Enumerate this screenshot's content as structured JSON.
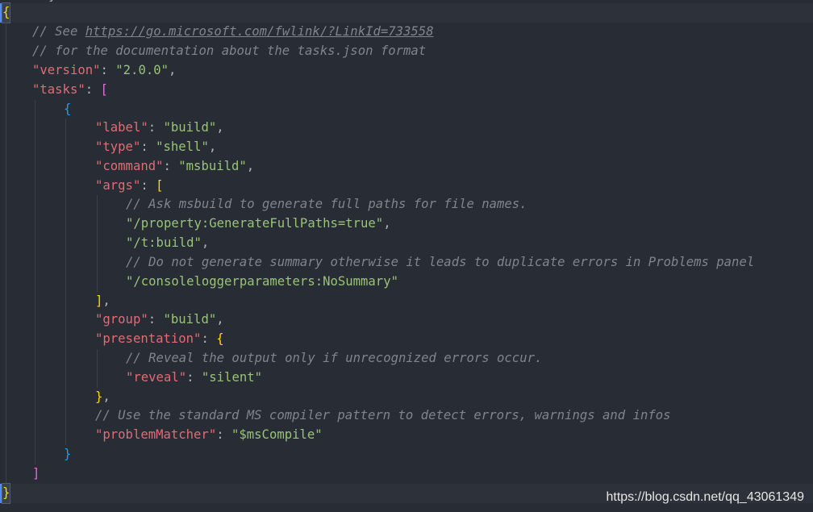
{
  "editor": {
    "comment_see": "// See ",
    "link": "https://go.microsoft.com/fwlink/?LinkId=733558",
    "comment_docs": "// for the documentation about the tasks.json format",
    "version_key": "\"version\"",
    "version_value": "\"2.0.0\"",
    "tasks_key": "\"tasks\"",
    "label_key": "\"label\"",
    "label_value": "\"build\"",
    "type_key": "\"type\"",
    "type_value": "\"shell\"",
    "command_key": "\"command\"",
    "command_value": "\"msbuild\"",
    "args_key": "\"args\"",
    "comment_args": "// Ask msbuild to generate full paths for file names.",
    "arg1": "\"/property:GenerateFullPaths=true\"",
    "arg2": "\"/t:build\"",
    "comment_summary": "// Do not generate summary otherwise it leads to duplicate errors in Problems panel",
    "arg3": "\"/consoleloggerparameters:NoSummary\"",
    "group_key": "\"group\"",
    "group_value": "\"build\"",
    "presentation_key": "\"presentation\"",
    "comment_reveal": "// Reveal the output only if unrecognized errors occur.",
    "reveal_key": "\"reveal\"",
    "reveal_value": "\"silent\"",
    "comment_matcher": "// Use the standard MS compiler pattern to detect errors, warnings and infos",
    "matcher_key": "\"problemMatcher\"",
    "matcher_value": "\"$msCompile\""
  },
  "watermark": "https://blog.csdn.net/qq_43061349",
  "colors": {
    "background": "#282c34",
    "comment": "#7f848e",
    "key": "#e06c75",
    "string": "#98c379",
    "bracket_level1": "#ffd700",
    "bracket_level2": "#da70d6",
    "bracket_level3": "#179fff"
  }
}
